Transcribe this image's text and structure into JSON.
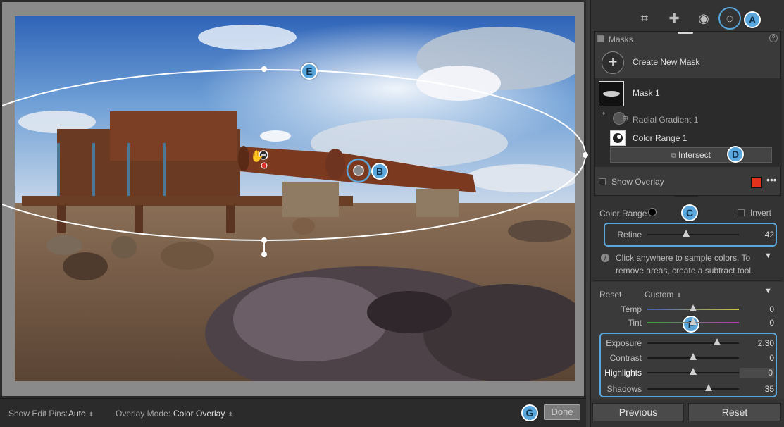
{
  "toolbar": {
    "edit_pins_label": "Show Edit Pins:",
    "edit_pins_value": "Auto",
    "overlay_mode_label": "Overlay Mode:",
    "overlay_mode_value": "Color Overlay",
    "done_label": "Done"
  },
  "callouts": {
    "a": "A",
    "b": "B",
    "c": "C",
    "d": "D",
    "e": "E",
    "f": "F",
    "g": "G"
  },
  "masks": {
    "title": "Masks",
    "create_label": "Create New Mask",
    "mask_name": "Mask 1",
    "component_1": "Radial Gradient 1",
    "component_2": "Color Range 1",
    "intersect_label": "Intersect",
    "show_overlay_label": "Show Overlay",
    "overlay_color": "#e2321d"
  },
  "color_range": {
    "label": "Color Range",
    "invert_label": "Invert",
    "refine_label": "Refine",
    "refine_value": "42",
    "refine_level": 0.42,
    "info_text_1": "Click anywhere to sample colors. To",
    "info_text_2": "remove areas, create a subtract tool."
  },
  "adjust": {
    "reset_label": "Reset",
    "preset_value": "Custom",
    "sliders": [
      {
        "label": "Temp",
        "value": "0",
        "level": 0.5
      },
      {
        "label": "Tint",
        "value": "0",
        "level": 0.5
      },
      {
        "label": "Exposure",
        "value": "2.30",
        "level": 0.76
      },
      {
        "label": "Contrast",
        "value": "0",
        "level": 0.5
      },
      {
        "label": "Highlights",
        "value": "0",
        "level": 0.5
      },
      {
        "label": "Shadows",
        "value": "35",
        "level": 0.67
      }
    ]
  },
  "footer": {
    "previous_label": "Previous",
    "reset_label": "Reset"
  },
  "colors": {
    "accent": "#5aa7dd",
    "panel": "#333333"
  }
}
